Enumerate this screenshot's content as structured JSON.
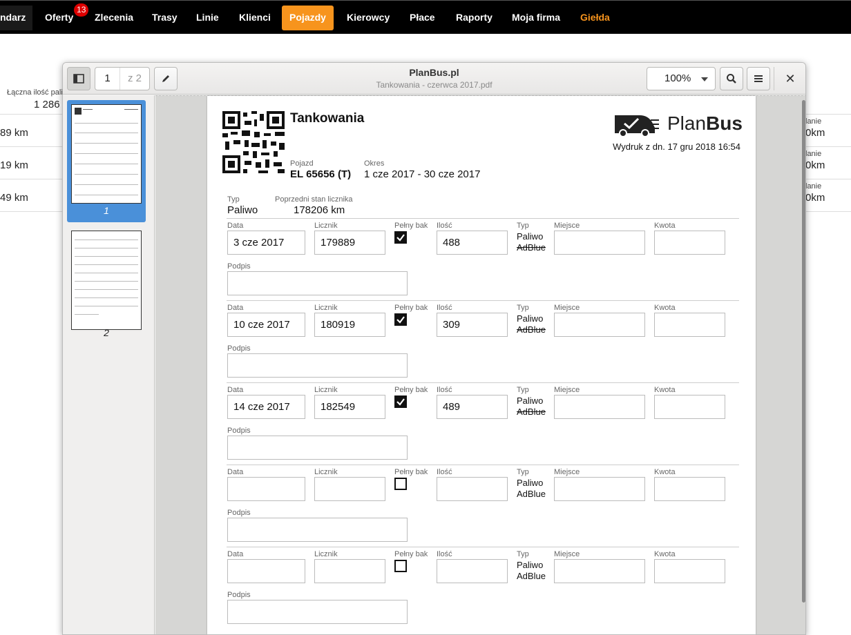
{
  "nav": {
    "items": [
      {
        "label": "ndarz"
      },
      {
        "label": "Oferty",
        "badge": "13"
      },
      {
        "label": "Zlecenia"
      },
      {
        "label": "Trasy"
      },
      {
        "label": "Linie"
      },
      {
        "label": "Klienci"
      },
      {
        "label": "Pojazdy"
      },
      {
        "label": "Kierowcy"
      },
      {
        "label": "Płace"
      },
      {
        "label": "Raporty"
      },
      {
        "label": "Moja firma"
      },
      {
        "label": "Giełda"
      }
    ],
    "active_color": "#f7941d"
  },
  "background": {
    "left_label": "Łączna ilość paliw",
    "left_total": "1 286",
    "left_rows": [
      "89 km",
      "19 km",
      "49 km"
    ],
    "right_label": "lanie",
    "right_rows": [
      "0km",
      "0km",
      "0km"
    ]
  },
  "viewer": {
    "title": "PlanBus.pl",
    "subtitle": "Tankowania - czerwca 2017.pdf",
    "page_current": "1",
    "page_total": "z 2",
    "zoom": "100%",
    "thumb_labels": [
      "1",
      "2"
    ]
  },
  "doc": {
    "title": "Tankowania",
    "logo_text_light": "Plan",
    "logo_text_bold": "Bus",
    "printed": "Wydruk z dn. 17 gru 2018 16:54",
    "vehicle_label": "Pojazd",
    "vehicle": "EL 65656 (T)",
    "period_label": "Okres",
    "period": "1 cze 2017 - 30 cze 2017",
    "type_label": "Typ",
    "type": "Paliwo",
    "prev_label": "Poprzedni stan licznika",
    "prev": "178206 km",
    "col_labels": {
      "date": "Data",
      "meter": "Licznik",
      "full": "Pełny bak",
      "qty": "Ilość",
      "type": "Typ",
      "place": "Miejsce",
      "amount": "Kwota",
      "sign": "Podpis"
    },
    "type_options": [
      "Paliwo",
      "AdBlue"
    ],
    "entries": [
      {
        "date": "3 cze 2017",
        "meter": "179889",
        "full": true,
        "qty": "488",
        "adblue_struck": true
      },
      {
        "date": "10 cze 2017",
        "meter": "180919",
        "full": true,
        "qty": "309",
        "adblue_struck": true
      },
      {
        "date": "14 cze 2017",
        "meter": "182549",
        "full": true,
        "qty": "489",
        "adblue_struck": true
      },
      {
        "date": "",
        "meter": "",
        "full": false,
        "qty": "",
        "adblue_struck": false
      },
      {
        "date": "",
        "meter": "",
        "full": false,
        "qty": "",
        "adblue_struck": false
      }
    ]
  }
}
